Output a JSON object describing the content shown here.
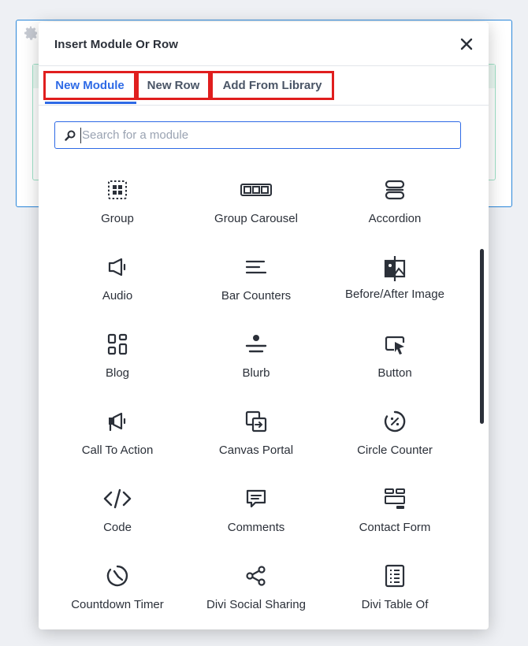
{
  "modal": {
    "title": "Insert Module Or Row"
  },
  "tabs": [
    {
      "label": "New Module",
      "active": true
    },
    {
      "label": "New Row",
      "active": false
    },
    {
      "label": "Add From Library",
      "active": false
    }
  ],
  "search": {
    "placeholder": "Search for a module",
    "value": ""
  },
  "modules": [
    {
      "label": "Group",
      "icon": "group-icon"
    },
    {
      "label": "Group Carousel",
      "icon": "group-carousel-icon"
    },
    {
      "label": "Accordion",
      "icon": "accordion-icon"
    },
    {
      "label": "Audio",
      "icon": "audio-icon"
    },
    {
      "label": "Bar Counters",
      "icon": "bar-counters-icon"
    },
    {
      "label": "Before/After Image",
      "icon": "before-after-image-icon"
    },
    {
      "label": "Blog",
      "icon": "blog-icon"
    },
    {
      "label": "Blurb",
      "icon": "blurb-icon"
    },
    {
      "label": "Button",
      "icon": "button-icon"
    },
    {
      "label": "Call To Action",
      "icon": "call-to-action-icon"
    },
    {
      "label": "Canvas Portal",
      "icon": "canvas-portal-icon"
    },
    {
      "label": "Circle Counter",
      "icon": "circle-counter-icon"
    },
    {
      "label": "Code",
      "icon": "code-icon"
    },
    {
      "label": "Comments",
      "icon": "comments-icon"
    },
    {
      "label": "Contact Form",
      "icon": "contact-form-icon"
    },
    {
      "label": "Countdown Timer",
      "icon": "countdown-timer-icon"
    },
    {
      "label": "Divi Social Sharing",
      "icon": "social-sharing-icon"
    },
    {
      "label": "Divi Table Of",
      "icon": "table-of-contents-icon"
    }
  ],
  "colors": {
    "accent": "#2e6ae6",
    "highlight_box": "#e01e1e",
    "text": "#2b3039"
  }
}
